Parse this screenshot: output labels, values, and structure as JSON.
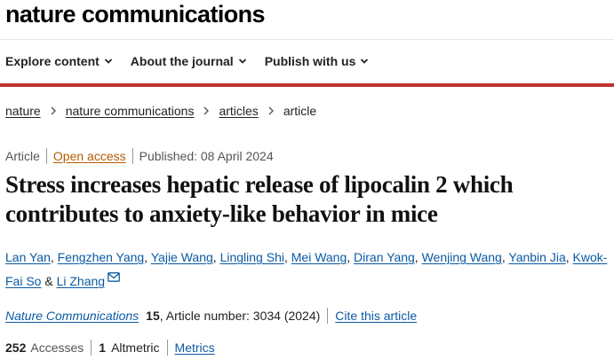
{
  "header": {
    "brand": "nature communications"
  },
  "nav": {
    "items": [
      {
        "label": "Explore content",
        "icon": "chevron-down-icon"
      },
      {
        "label": "About the journal",
        "icon": "chevron-down-icon"
      },
      {
        "label": "Publish with us",
        "icon": "chevron-down-icon"
      }
    ]
  },
  "colors": {
    "accent_rule": "#c0312e",
    "link": "#0b5aa4",
    "open_access": "#b55a00"
  },
  "breadcrumb": {
    "items": [
      "nature",
      "nature communications",
      "articles"
    ],
    "current": "article",
    "separator_icon": "chevron-right-icon"
  },
  "meta": {
    "type": "Article",
    "access": "Open access",
    "published": "Published: 08 April 2024"
  },
  "article": {
    "title": "Stress increases hepatic release of lipocalin 2 which contributes to anxiety-like behavior in mice",
    "authors": [
      "Lan Yan",
      "Fengzhen Yang",
      "Yajie Wang",
      "Lingling Shi",
      "Mei Wang",
      "Diran Yang",
      "Wenjing Wang",
      "Yanbin Jia",
      "Kwok-Fai So",
      "Li Zhang"
    ],
    "author_separator": ", ",
    "author_last_separator": " & ",
    "contact_icon": "mail-icon"
  },
  "citation": {
    "journal": "Nature Communications",
    "volume": "15",
    "article_number": ", Article number: 3034 (2024)",
    "cite_label": "Cite this article"
  },
  "metrics": {
    "accesses_count": "252",
    "accesses_label": "Accesses",
    "altmetric_count": "1",
    "altmetric_label": "Altmetric",
    "metrics_label": "Metrics"
  }
}
